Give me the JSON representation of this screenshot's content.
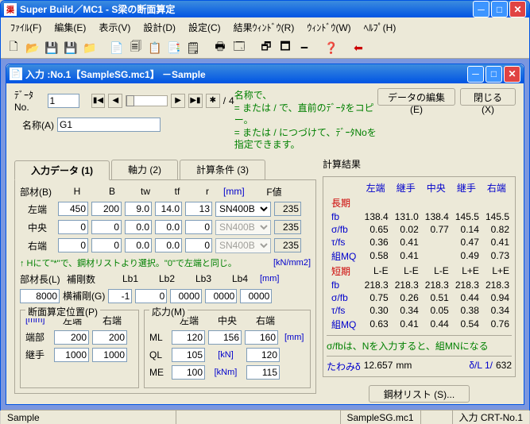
{
  "window": {
    "title": "Super Build／MC1 - S梁の断面算定"
  },
  "menu": [
    "ﾌｧｲﾙ(F)",
    "編集(E)",
    "表示(V)",
    "設計(D)",
    "設定(C)",
    "結果ｳｨﾝﾄﾞｳ(R)",
    "ｳｨﾝﾄﾞｳ(W)",
    "ﾍﾙﾌﾟ(H)"
  ],
  "child": {
    "title": "入力 :No.1【SampleSG.mc1】 －Sample"
  },
  "top": {
    "dataNoLabel": "ﾃﾞｰﾀNo.",
    "dataNo": "1",
    "totalSep": "/",
    "total": "4",
    "nameLabel": "名称(A)",
    "name": "G1",
    "editBtn": "データの編集(E)",
    "closeBtn": "閉じる (X)",
    "help1": "名称で、",
    "help2": "= または / で、直前のﾃﾞｰﾀをコピー。",
    "help3": "= または / につづけて、ﾃﾞｰﾀNoを指定できます。"
  },
  "tabs": [
    "入力データ (1)",
    "軸力 (2)",
    "計算条件 (3)"
  ],
  "sec": {
    "memberLabel": "部材(B)",
    "hdr": [
      "H",
      "B",
      "tw",
      "tf",
      "r",
      "[mm]",
      "F値"
    ],
    "rows": [
      {
        "n": "左端",
        "v": [
          "450",
          "200",
          "9.0",
          "14.0",
          "13"
        ],
        "steel": "SN400B",
        "f": "235",
        "steelEn": true
      },
      {
        "n": "中央",
        "v": [
          "0",
          "0",
          "0.0",
          "0.0",
          "0"
        ],
        "steel": "SN400B",
        "f": "235",
        "steelEn": false
      },
      {
        "n": "右端",
        "v": [
          "0",
          "0",
          "0.0",
          "0.0",
          "0"
        ],
        "steel": "SN400B",
        "f": "235",
        "steelEn": false
      }
    ],
    "note": "↑ Hにて\"*\"で、鋼材リストより選択。\"0\"で左端と同じ。",
    "unit": "[kN/mm2]"
  },
  "len": {
    "label": "部材長(L)",
    "hokoLabel": "補剛数",
    "hokoGLabel": "横補剛(G)",
    "lbHdr": [
      "Lb1",
      "Lb2",
      "Lb3",
      "Lb4"
    ],
    "lbUnit": "[mm]",
    "L": "8000",
    "G": "-1",
    "lb": [
      "0",
      "0000",
      "0000",
      "0000"
    ]
  },
  "pos": {
    "grpLabel": "断面算定位置(P)",
    "unit": "[mm]",
    "cols": [
      "左端",
      "右端"
    ],
    "rows": [
      {
        "n": "端部",
        "v": [
          "200",
          "200"
        ]
      },
      {
        "n": "継手",
        "v": [
          "1000",
          "1000"
        ]
      }
    ]
  },
  "stress": {
    "grpLabel": "応力(M)",
    "cols": [
      "左端",
      "中央",
      "右端"
    ],
    "rows": [
      {
        "n": "ML",
        "v": [
          "120",
          "156",
          "160"
        ],
        "u": "[mm]"
      },
      {
        "n": "QL",
        "v": [
          "105",
          "",
          "120"
        ],
        "u": "[kN]"
      },
      {
        "n": "ME",
        "v": [
          "100",
          "",
          "115"
        ],
        "u": "[kNm]"
      }
    ]
  },
  "res": {
    "title": "計算結果",
    "cols": [
      "左端",
      "継手",
      "中央",
      "継手",
      "右端"
    ],
    "long": "長期",
    "short": "短期",
    "rows1": [
      {
        "n": "fb",
        "v": [
          "138.4",
          "131.0",
          "138.4",
          "145.5",
          "145.5"
        ]
      },
      {
        "n": "σ/fb",
        "v": [
          "0.65",
          "0.02",
          "0.77",
          "0.14",
          "0.82"
        ]
      },
      {
        "n": "τ/fs",
        "v": [
          "0.36",
          "0.41",
          "",
          "0.47",
          "0.41"
        ]
      },
      {
        "n": "組MQ",
        "v": [
          "0.58",
          "0.41",
          "",
          "0.49",
          "0.73"
        ]
      }
    ],
    "rows2hdr": [
      "L-E",
      "L-E",
      "L-E",
      "L+E",
      "L+E"
    ],
    "rows2": [
      {
        "n": "fb",
        "v": [
          "218.3",
          "218.3",
          "218.3",
          "218.3",
          "218.3"
        ]
      },
      {
        "n": "σ/fb",
        "v": [
          "0.75",
          "0.26",
          "0.51",
          "0.44",
          "0.94"
        ]
      },
      {
        "n": "τ/fs",
        "v": [
          "0.30",
          "0.34",
          "0.05",
          "0.38",
          "0.34"
        ]
      },
      {
        "n": "組MQ",
        "v": [
          "0.63",
          "0.41",
          "0.44",
          "0.54",
          "0.76"
        ]
      }
    ],
    "note": "σ/fbは、Nを入力すると、組MNになる",
    "def": {
      "label": "たわみδ",
      "val": "12.657",
      "unit": "mm",
      "rl": "δ/L 1/",
      "rv": "632"
    },
    "listBtn": "鋼材リスト (S)..."
  },
  "status": {
    "s1": "Sample",
    "s2": "SampleSG.mc1",
    "s3": "入力 CRT-No.1"
  }
}
